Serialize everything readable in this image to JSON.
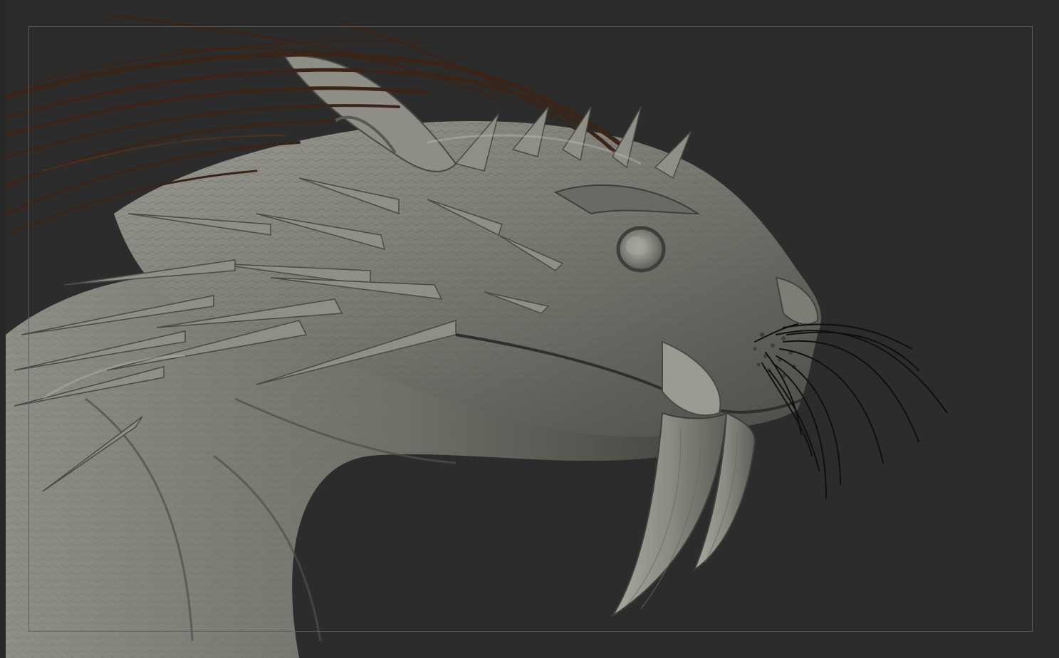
{
  "app": {
    "view": "3d-sculpt-viewport"
  },
  "viewport": {
    "background_color": "#2c2c2c",
    "frame_color": "#5e5e5e"
  },
  "model": {
    "skin_color": "#8a8a82",
    "skin_shadow": "#3c3c38",
    "skin_highlight": "#c9c9c0",
    "hair_color": "#3a2418",
    "whisker_color": "#0f0f0f"
  }
}
